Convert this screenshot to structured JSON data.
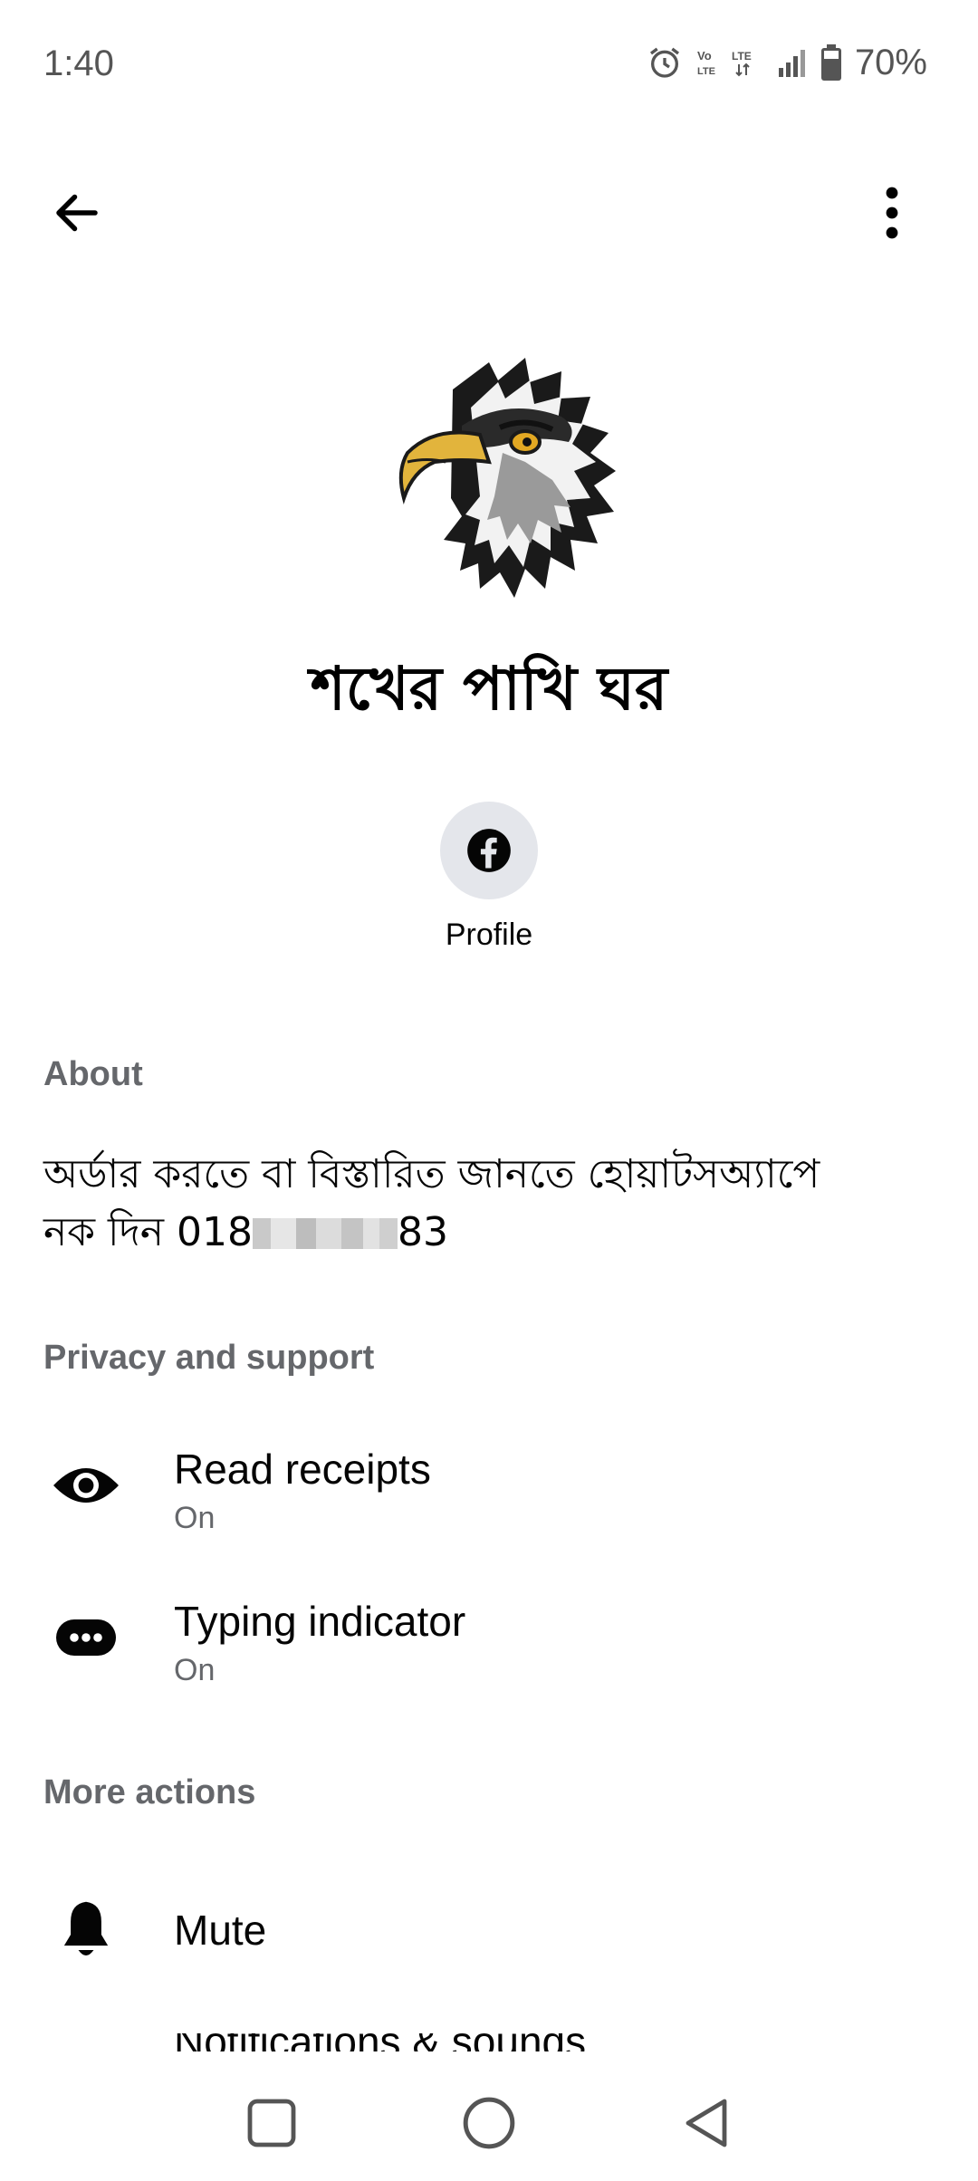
{
  "status_bar": {
    "time": "1:40",
    "battery": "70%",
    "icons": [
      "alarm-icon",
      "volte-icon",
      "lte-icon",
      "signal-icon",
      "battery-icon"
    ]
  },
  "app_bar": {
    "back_icon": "arrow-left-icon",
    "more_icon": "more-vertical-icon"
  },
  "page": {
    "name": "শখের পাখি ঘর",
    "avatar": "eagle-head-logo"
  },
  "actions": {
    "profile_label": "Profile",
    "profile_icon": "facebook-icon"
  },
  "about": {
    "header": "About",
    "text_line1": "অর্ডার করতে বা বিস্তারিত জানতে হোয়াটসঅ্যাপে",
    "text_line2_prefix": "নক দিন 018",
    "text_line2_suffix": "83"
  },
  "privacy": {
    "header": "Privacy and support",
    "items": [
      {
        "title": "Read receipts",
        "subtitle": "On",
        "icon": "eye-icon"
      },
      {
        "title": "Typing indicator",
        "subtitle": "On",
        "icon": "typing-bubble-icon"
      }
    ]
  },
  "more_actions": {
    "header": "More actions",
    "items": [
      {
        "title": "Mute",
        "icon": "bell-icon"
      },
      {
        "title": "Notifications & sounds"
      }
    ]
  },
  "nav_bar": {
    "icons": [
      "recents-square-icon",
      "home-circle-icon",
      "back-triangle-icon"
    ]
  }
}
